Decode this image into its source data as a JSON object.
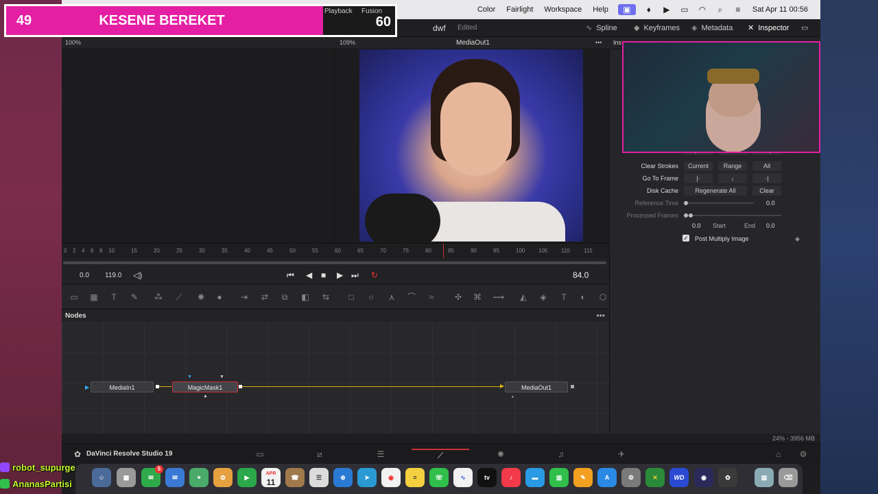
{
  "menubar": {
    "items": [
      "Color",
      "Fairlight",
      "Workspace",
      "Help"
    ],
    "clock": "Sat Apr 11  00:56"
  },
  "score": {
    "left_number": "49",
    "team": "KESENE BEREKET",
    "label_playback": "Playback",
    "label_fusion": "Fusion",
    "right_number": "60"
  },
  "app": {
    "project": "dwf",
    "status": "Edited",
    "toolbar": {
      "spline": "Spline",
      "keyframes": "Keyframes",
      "metadata": "Metadata",
      "inspector": "Inspector"
    },
    "viewer": {
      "left_zoom": "100%",
      "right_zoom": "109%",
      "right_title": "MediaOut1"
    },
    "inspector": {
      "tab_stub": "Ins",
      "clear_strokes_label": "Clear Strokes",
      "clear_strokes_options": [
        "Current",
        "Range",
        "All"
      ],
      "go_to_frame_label": "Go To Frame",
      "disk_cache_label": "Disk Cache",
      "regenerate_all": "Regenerate All",
      "clear": "Clear",
      "reference_time_label": "Reference Time",
      "reference_time_value": "0.0",
      "processed_frames_label": "Processed Frames",
      "start_value": "0.0",
      "start_label": "Start",
      "end_label": "End",
      "end_value": "0.0",
      "post_multiply_label": "Post Multiply Image"
    },
    "ruler_ticks": [
      "0",
      "2",
      "4",
      "6",
      "8",
      "10",
      "15",
      "20",
      "25",
      "30",
      "35",
      "40",
      "45",
      "50",
      "55",
      "60",
      "65",
      "70",
      "75",
      "80",
      "85",
      "90",
      "95",
      "100",
      "105",
      "110",
      "115"
    ],
    "transport": {
      "start": "0.0",
      "end": "119.0",
      "current": "84.0"
    },
    "nodes_title": "Nodes",
    "nodes": [
      {
        "name": "MediaIn1"
      },
      {
        "name": "MagicMask1"
      },
      {
        "name": "MediaOut1"
      }
    ],
    "memory": "24% - 3956 MB",
    "app_name": "DaVinci Resolve Studio 19"
  },
  "chat": [
    {
      "user": "robot_supurge"
    },
    {
      "user": "AnanasPartisi"
    }
  ],
  "dock": {
    "calendar_month": "APR",
    "calendar_day": "11",
    "badge": "5",
    "tv_label": "tv"
  },
  "colors": {
    "accent_pink": "#e51fa3",
    "wire": "#d4b21a",
    "playhead": "#cc3333"
  }
}
